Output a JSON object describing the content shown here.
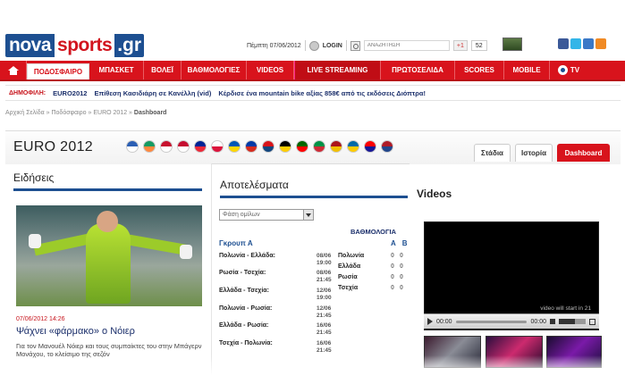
{
  "header": {
    "logo": {
      "part1": "nova",
      "part2": "sports",
      "part3": ".gr"
    },
    "date": "Πέμπτη 07/06/2012",
    "login_label": "LOGIN",
    "search_placeholder": "ΑΝΑΖΗΤΗΣΗ",
    "gplus_label": "+1",
    "gplus_count": "52",
    "social_icons": [
      "facebook-icon",
      "twitter-icon",
      "youtube-icon",
      "rss-icon"
    ]
  },
  "nav": {
    "items": [
      {
        "label": "ΠΟΔΟΣΦΑΙΡΟ",
        "active": true
      },
      {
        "label": "ΜΠΑΣΚΕΤ"
      },
      {
        "label": "ΒΟΛΕΪ"
      },
      {
        "label": "ΒΑΘΜΟΛΟΓΙΕΣ"
      },
      {
        "label": "VIDEOS"
      },
      {
        "label": "LIVE STREAMING"
      },
      {
        "label": "ΠΡΩΤΟΣΕΛΙΔΑ"
      },
      {
        "label": "SCORES"
      },
      {
        "label": "MOBILE"
      },
      {
        "label": "TV"
      }
    ]
  },
  "hot_news": {
    "label": "ΔΗΜΟΦΙΛΗ:",
    "links": [
      "EURO2012",
      "Επίθεση Κασιδιάρη σε Κανέλλη (vid)",
      "Κέρδισε ένα mountain bike αξίας 858€ από τις εκδόσεις Διόπτρα!"
    ]
  },
  "breadcrumb": {
    "items": [
      "Αρχική Σελίδα",
      "Ποδόσφαιρο",
      "EURO 2012"
    ],
    "current": "Dashboard",
    "separator": " » "
  },
  "page": {
    "title": "EURO 2012",
    "flag_colors": [
      [
        "#2b5fb4",
        "#ffffff"
      ],
      [
        "#169b62",
        "#ff883e"
      ],
      [
        "#c8102e",
        "#ffffff"
      ],
      [
        "#c60c30",
        "#ffffff"
      ],
      [
        "#002395",
        "#ed2939"
      ],
      [
        "#ffffff",
        "#dc143c"
      ],
      [
        "#0057b7",
        "#ffd700"
      ],
      [
        "#0039a6",
        "#d52b1e"
      ],
      [
        "#d7141a",
        "#11457e"
      ],
      [
        "#000000",
        "#ffce00"
      ],
      [
        "#006600",
        "#ff0000"
      ],
      [
        "#009246",
        "#ce2b37"
      ],
      [
        "#aa151b",
        "#f1bf00"
      ],
      [
        "#006aa7",
        "#fecc00"
      ],
      [
        "#ff0000",
        "#171796"
      ],
      [
        "#ae1c28",
        "#21468b"
      ]
    ],
    "tabs": [
      {
        "label": "Στάδια"
      },
      {
        "label": "Ιστορία"
      },
      {
        "label": "Dashboard",
        "active": true
      }
    ]
  },
  "news": {
    "section_title": "Ειδήσεις",
    "date": "07/06/2012 14:26",
    "headline": "Ψάχνει «φάρμακο» ο Νόιερ",
    "excerpt": "Για τον Μανουέλ Νόιερ και τους συμπαίκτες του στην Μπάγερν Μονάχου, το κλείσιμο της σεζόν"
  },
  "results": {
    "section_title": "Αποτελέσματα",
    "phase_selected": "Φάση ομίλων",
    "standings_label": "ΒΑΘΜΟΛΟΓΙΑ",
    "group_label": "Γκρουπ Α",
    "col_a": "A",
    "col_b": "B",
    "matches": [
      {
        "teams": "Πολωνία - Ελλάδα:",
        "date": "08/06",
        "time": "19:00"
      },
      {
        "teams": "Ρωσία - Τσεχία:",
        "date": "08/06",
        "time": "21:45"
      },
      {
        "teams": "Ελλάδα - Τσεχία:",
        "date": "12/06",
        "time": "19:00"
      },
      {
        "teams": "Πολωνία - Ρωσία:",
        "date": "12/06",
        "time": "21:45"
      },
      {
        "teams": "Ελλάδα - Ρωσία:",
        "date": "16/06",
        "time": "21:45"
      },
      {
        "teams": "Τσεχία - Πολωνία:",
        "date": "16/06",
        "time": "21:45"
      }
    ],
    "standings": [
      {
        "team": "Πολωνία",
        "a": "0",
        "b": "0"
      },
      {
        "team": "Ελλάδα",
        "a": "0",
        "b": "0"
      },
      {
        "team": "Ρωσία",
        "a": "0",
        "b": "0"
      },
      {
        "team": "Τσεχία",
        "a": "0",
        "b": "0"
      }
    ]
  },
  "videos": {
    "section_title": "Videos",
    "player_notice": "video will start in 21",
    "current_time": "00:00",
    "duration": "00:00"
  }
}
